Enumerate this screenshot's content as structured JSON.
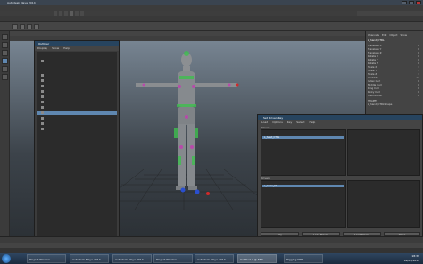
{
  "app": {
    "title": "Autodesk Maya 2014"
  },
  "outliner": {
    "title": "Outliner",
    "menus": [
      "Display",
      "Show",
      "Help"
    ]
  },
  "set_driven_key": {
    "title": "Set Driven Key",
    "menus": [
      "Load",
      "Options",
      "Key",
      "Select",
      "Help"
    ],
    "driver_label": "Driver",
    "driven_label": "Driven",
    "driver_object": "L_hand_CTRL",
    "driven_object": "L_index_01",
    "buttons": {
      "key": "Key",
      "load_driver": "Load Driver",
      "load_driven": "Load Driven",
      "close": "Close"
    }
  },
  "channel_box": {
    "tabs": [
      "Channels",
      "Edit",
      "Object",
      "Show"
    ],
    "object_name": "L_hand_CTRL",
    "attrs": [
      {
        "name": "Translate X",
        "value": "0"
      },
      {
        "name": "Translate Y",
        "value": "0"
      },
      {
        "name": "Translate Z",
        "value": "0"
      },
      {
        "name": "Rotate X",
        "value": "0"
      },
      {
        "name": "Rotate Y",
        "value": "0"
      },
      {
        "name": "Rotate Z",
        "value": "0"
      },
      {
        "name": "Scale X",
        "value": "1"
      },
      {
        "name": "Scale Y",
        "value": "1"
      },
      {
        "name": "Scale Z",
        "value": "1"
      },
      {
        "name": "Visibility",
        "value": "on"
      },
      {
        "name": "Index Curl",
        "value": "0"
      },
      {
        "name": "Middle Curl",
        "value": "0"
      },
      {
        "name": "Ring Curl",
        "value": "0"
      },
      {
        "name": "Pinky Curl",
        "value": "0"
      },
      {
        "name": "Thumb Curl",
        "value": "0"
      }
    ],
    "shapes_label": "SHAPES",
    "shape_name": "L_hand_CTRLShape"
  },
  "taskbar": {
    "items": [
      "Project Window",
      "Autodesk Maya 2014",
      "Autodesk Maya 2014",
      "Project Window",
      "Autodesk Maya 2014",
      "Untitled-1 @ 66%",
      "Rigging WIP"
    ],
    "clock_time": "18:39",
    "clock_date": "01/03/2014"
  },
  "colors": {
    "selection": "#5f87b0",
    "title_bar": "#27445f",
    "panel_bg": "#444444",
    "list_bg": "#2b2b2b"
  }
}
